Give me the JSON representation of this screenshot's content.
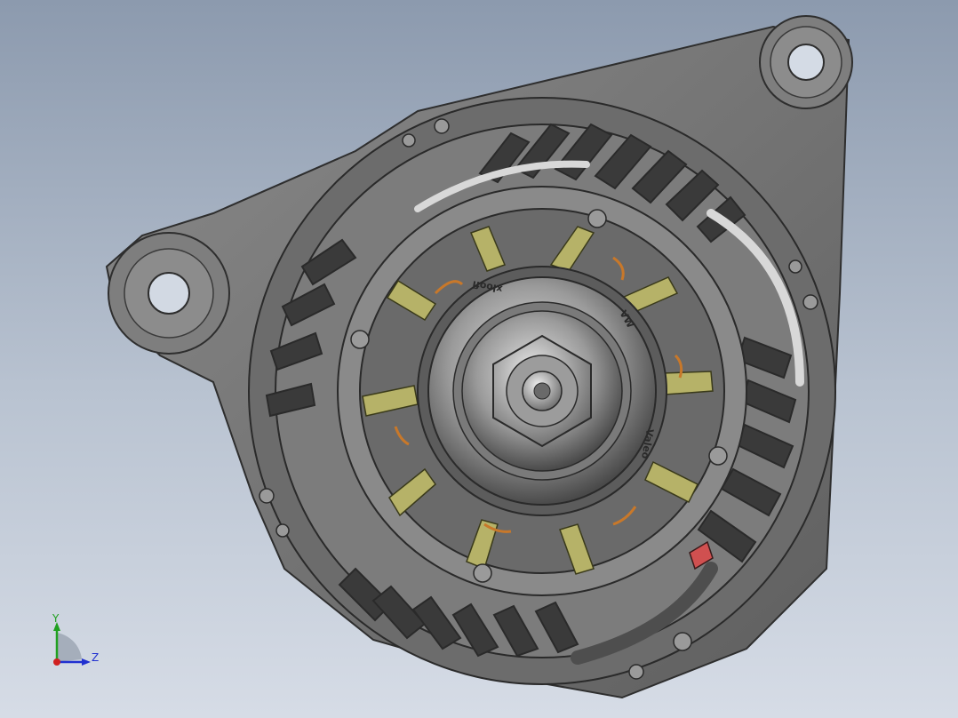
{
  "scene": {
    "engraving_top": "xloofi",
    "engraving_right": "VW",
    "engraving_brand": "Valeo"
  },
  "triad": {
    "y_label": "Y",
    "z_label": "Z"
  },
  "colors": {
    "background_top": "#8c9aae",
    "background_bottom": "#d6dce6",
    "body": "#707070",
    "bracket": "#7a7a7a",
    "pulley": "#9a9a9a",
    "blades": "#b6b268",
    "winding": "#c8782a",
    "connector": "#d05050",
    "axis_x": "#d02020",
    "axis_y": "#20a020",
    "axis_z": "#2030d0"
  }
}
